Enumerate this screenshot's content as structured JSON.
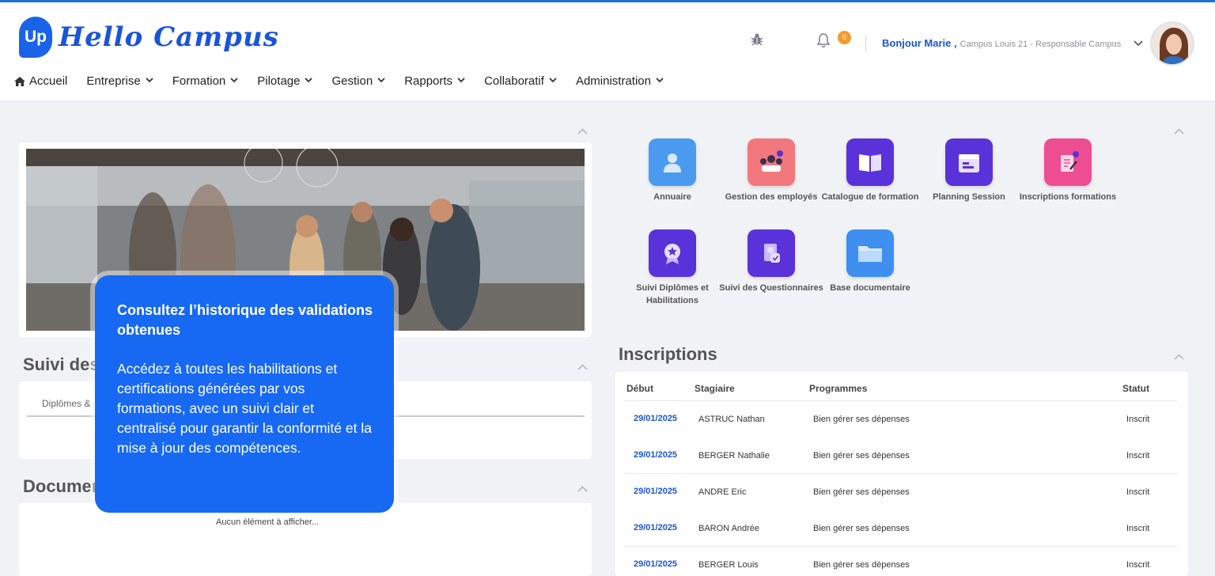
{
  "brand": {
    "logo_badge": "Up",
    "name": "Hello Campus",
    "accent": "#1a63e8"
  },
  "header": {
    "notifications_count": "0",
    "greeting": "Bonjour Marie ,",
    "user_role": "Campus Louis 21 - Responsable Campus",
    "icons": [
      "bug-icon",
      "bell-icon",
      "chevron-down-icon",
      "avatar"
    ]
  },
  "nav": {
    "items": [
      {
        "label": "Accueil",
        "icon": "home-icon"
      },
      {
        "label": "Entreprise"
      },
      {
        "label": "Formation"
      },
      {
        "label": "Pilotage"
      },
      {
        "label": "Gestion"
      },
      {
        "label": "Rapports"
      },
      {
        "label": "Collaboratif"
      },
      {
        "label": "Administration"
      }
    ]
  },
  "left": {
    "suivi_title": "Suivi des",
    "suivi_tab": "Diplômes &",
    "documents_title": "Documen",
    "documents_empty": "Aucun élément à afficher..."
  },
  "popup": {
    "title": "Consultez l’historique des validations obtenues",
    "body": "Accédez à toutes les habilitations et certifications générées par vos formations, avec un suivi clair et centralisé pour garantir la conformité et la mise à jour des compétences."
  },
  "apps": [
    {
      "label": "Annuaire",
      "icon": "user-icon",
      "color": "#4a9bf0"
    },
    {
      "label": "Gestion des employés",
      "icon": "team-icon",
      "color": "#f2787e"
    },
    {
      "label": "Catalogue de formation",
      "icon": "book-icon",
      "color": "#5a32d9"
    },
    {
      "label": "Planning Session",
      "icon": "calendar-icon",
      "color": "#5a32d9"
    },
    {
      "label": "Inscriptions formations",
      "icon": "clipboard-icon",
      "color": "#ee4d92"
    },
    {
      "label": "Suivi Diplômes et Habilitations",
      "icon": "award-icon",
      "color": "#5a32d9"
    },
    {
      "label": "Suivi des Questionnaires",
      "icon": "questionnaire-icon",
      "color": "#5a32d9"
    },
    {
      "label": "Base documentaire",
      "icon": "folder-icon",
      "color": "#3f8ff0"
    }
  ],
  "inscriptions": {
    "title": "Inscriptions",
    "columns": [
      "Début",
      "Stagiaire",
      "Programmes",
      "Statut"
    ],
    "rows": [
      {
        "date": "29/01/2025",
        "stagiaire": "ASTRUC Nathan",
        "programme": "Bien gérer ses dépenses",
        "statut": "Inscrit"
      },
      {
        "date": "29/01/2025",
        "stagiaire": "BERGER Nathalie",
        "programme": "Bien gérer ses dépenses",
        "statut": "Inscrit"
      },
      {
        "date": "29/01/2025",
        "stagiaire": "ANDRE Eric",
        "programme": "Bien gérer ses dépenses",
        "statut": "Inscrit"
      },
      {
        "date": "29/01/2025",
        "stagiaire": "BARON Andrée",
        "programme": "Bien gérer ses dépenses",
        "statut": "Inscrit"
      },
      {
        "date": "29/01/2025",
        "stagiaire": "BERGER Louis",
        "programme": "Bien gérer ses dépenses",
        "statut": "Inscrit"
      }
    ]
  }
}
